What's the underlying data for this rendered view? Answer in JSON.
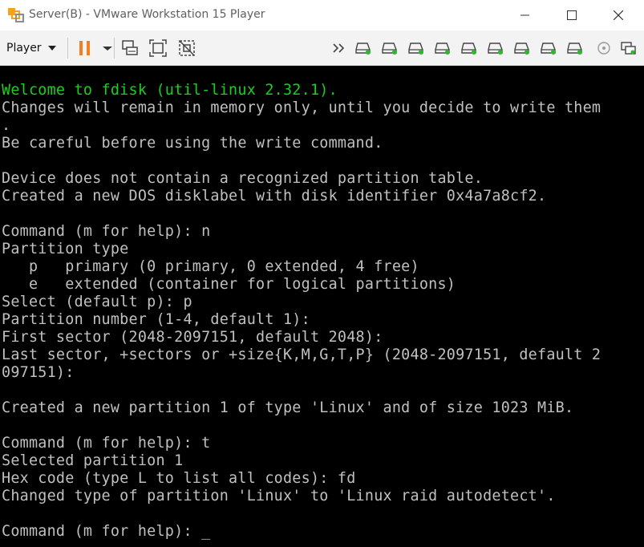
{
  "window": {
    "title": "Server(B) - VMware Workstation 15 Player"
  },
  "toolbar": {
    "player_label": "Player",
    "icons": [
      "pause-icon",
      "send-ctrl-alt-del-icon",
      "fit-guest-icon",
      "unity-icon",
      "more-icon",
      "hard-disk-icon",
      "network-adapter-icon",
      "cd-dvd-icon",
      "usb-icon",
      "sound-card-icon",
      "printer-icon",
      "display-icon",
      "floppy-icon",
      "message-icon"
    ]
  },
  "colors": {
    "console_bg": "#000000",
    "console_text": "#c0c0c0",
    "console_green": "#1ad01a",
    "pause_orange": "#f08020"
  },
  "console": {
    "lines": [
      "Welcome to fdisk (util-linux 2.32.1).",
      "Changes will remain in memory only, until you decide to write them",
      ".",
      "Be careful before using the write command.",
      "",
      "Device does not contain a recognized partition table.",
      "Created a new DOS disklabel with disk identifier 0x4a7a8cf2.",
      "",
      "Command (m for help): n",
      "Partition type",
      "   p   primary (0 primary, 0 extended, 4 free)",
      "   e   extended (container for logical partitions)",
      "Select (default p): p",
      "Partition number (1-4, default 1):",
      "First sector (2048-2097151, default 2048):",
      "Last sector, +sectors or +size{K,M,G,T,P} (2048-2097151, default 2",
      "097151):",
      "",
      "Created a new partition 1 of type 'Linux' and of size 1023 MiB.",
      "",
      "Command (m for help): t",
      "Selected partition 1",
      "Hex code (type L to list all codes): fd",
      "Changed type of partition 'Linux' to 'Linux raid autodetect'.",
      "",
      "Command (m for help): _"
    ]
  }
}
